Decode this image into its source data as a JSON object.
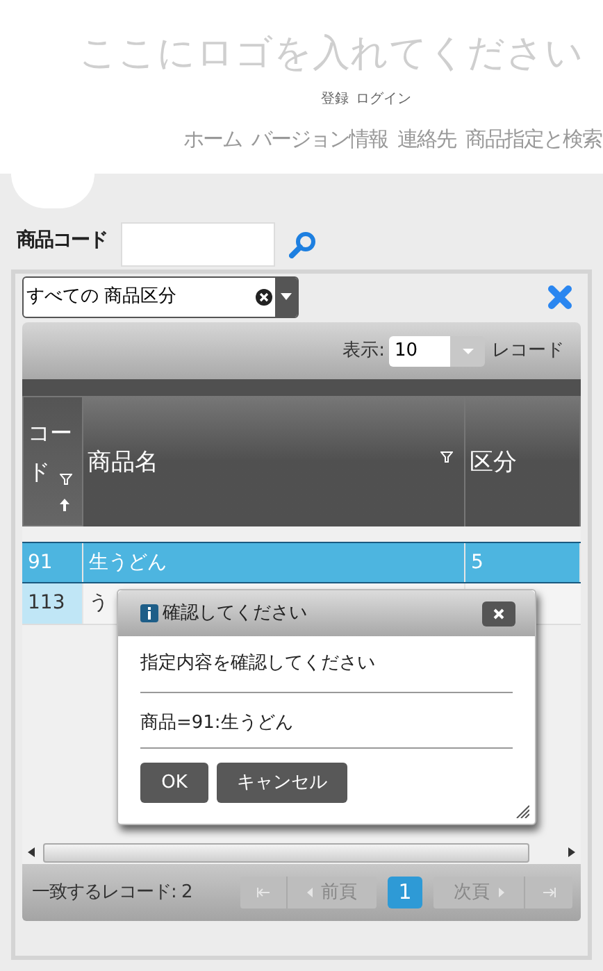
{
  "logo": "ここにロゴを入れてください",
  "account_links": [
    "登録",
    "ログイン"
  ],
  "nav": [
    "ホーム",
    "バージョン情報",
    "連絡先",
    "商品指定と検索"
  ],
  "search": {
    "label": "商品コード"
  },
  "category_filter": {
    "value": "すべての 商品区分"
  },
  "grid": {
    "page_size_label": "表示:",
    "page_size": "10",
    "page_size_unit": "レコード",
    "columns": [
      {
        "label": "コード",
        "filter": true,
        "sorted": true
      },
      {
        "label": "商品名",
        "filter": true,
        "sorted": false
      },
      {
        "label": "区分",
        "filter": false,
        "sorted": false
      }
    ],
    "rows": [
      {
        "cells": [
          "91",
          "生うどん",
          "5"
        ],
        "selected": true
      },
      {
        "cells": [
          "113",
          "う"
        ],
        "selected": false
      }
    ],
    "matches": "一致するレコード: 2",
    "pager": {
      "prev": "前頁",
      "pages": [
        {
          "label": "1",
          "selected": true
        }
      ],
      "next": "次頁"
    }
  },
  "dialog": {
    "title": "確認してください",
    "message": "指定内容を確認してください",
    "detail": "商品=91:生うどん",
    "buttons": [
      "OK",
      "キャンセル"
    ]
  }
}
